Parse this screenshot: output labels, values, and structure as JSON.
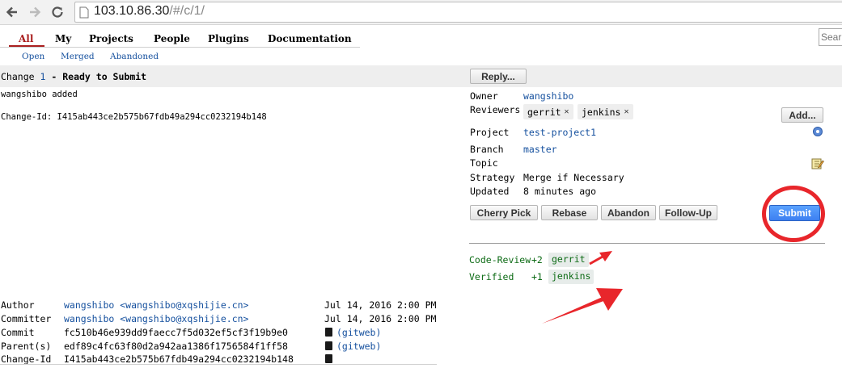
{
  "browser": {
    "url_host": "103.10.86.30",
    "url_path": "/#/c/1/"
  },
  "menu": {
    "items": [
      "All",
      "My",
      "Projects",
      "People",
      "Plugins",
      "Documentation"
    ],
    "submenu": [
      "Open",
      "Merged",
      "Abandoned"
    ],
    "search_placeholder": "Sear"
  },
  "change": {
    "prefix": "Change",
    "number": "1",
    "separator": "-",
    "status": "Ready to Submit",
    "reply_label": "Reply...",
    "message_line1": "wangshibo added",
    "message_line2": "Change-Id: I415ab443ce2b575b67fdb49a294cc0232194b148"
  },
  "info": {
    "owner_label": "Owner",
    "owner": "wangshibo",
    "reviewers_label": "Reviewers",
    "reviewers": [
      "gerrit",
      "jenkins"
    ],
    "add_label": "Add...",
    "project_label": "Project",
    "project": "test-project1",
    "branch_label": "Branch",
    "branch": "master",
    "topic_label": "Topic",
    "strategy_label": "Strategy",
    "strategy": "Merge if Necessary",
    "updated_label": "Updated",
    "updated": "8 minutes ago"
  },
  "actions": {
    "buttons": [
      "Cherry Pick",
      "Rebase",
      "Abandon",
      "Follow-Up"
    ],
    "submit": "Submit"
  },
  "labels": [
    {
      "name": "Code-Review",
      "score": "+2",
      "voter": "gerrit"
    },
    {
      "name": "Verified",
      "score": "+1",
      "voter": "jenkins"
    }
  ],
  "commit_info": {
    "author_label": "Author",
    "author": "wangshibo <wangshibo@xqshijie.cn>",
    "author_date": "Jul 14, 2016 2:00 PM",
    "committer_label": "Committer",
    "committer": "wangshibo <wangshibo@xqshijie.cn>",
    "committer_date": "Jul 14, 2016 2:00 PM",
    "commit_label": "Commit",
    "commit": "fc510b46e939dd9faecc7f5d032ef5cf3f19b9e0",
    "parent_label": "Parent(s)",
    "parent": "edf89c4fc63f80d2a942aa1386f1756584f1ff58",
    "changeid_label": "Change-Id",
    "changeid": "I415ab443ce2b575b67fdb49a294cc0232194b148",
    "gitweb": "(gitweb)"
  },
  "colors": {
    "link": "#15509e",
    "active_menu": "#aa1f1f",
    "approved_green": "#0d6b15",
    "submit_blue": "#3d7ff1",
    "annotation_red": "#e8262b"
  }
}
